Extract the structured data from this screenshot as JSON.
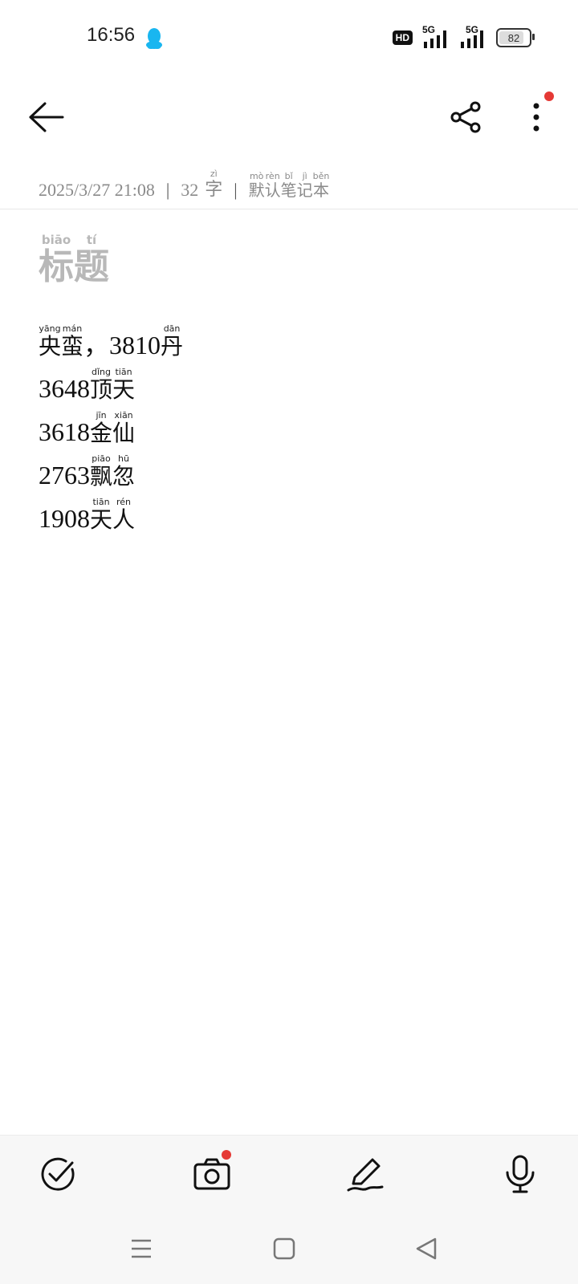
{
  "status_bar": {
    "time": "16:56",
    "network_badge": "HD",
    "sim1_label": "5G",
    "sim2_label": "5G",
    "battery_level": "82"
  },
  "toolbar": {
    "back_icon": "arrow-left-icon",
    "share_icon": "share-icon",
    "more_icon": "more-vertical-icon",
    "notification_color": "#e53935"
  },
  "meta": {
    "datetime": "2025/3/27 21:08",
    "separator": "|",
    "word_count": "32",
    "word_unit": "字",
    "word_unit_pinyin": "zì",
    "notebook": [
      {
        "char": "默",
        "pinyin": "mò"
      },
      {
        "char": "认",
        "pinyin": "rèn"
      },
      {
        "char": "笔",
        "pinyin": "bǐ"
      },
      {
        "char": "记",
        "pinyin": "jì"
      },
      {
        "char": "本",
        "pinyin": "běn"
      }
    ]
  },
  "note": {
    "title": [
      {
        "char": "标",
        "pinyin": "biāo"
      },
      {
        "char": "题",
        "pinyin": "tí"
      }
    ],
    "lines": [
      {
        "parts": [
          {
            "char": "央",
            "pinyin": "yāng"
          },
          {
            "char": "蛮",
            "pinyin": "mán"
          },
          {
            "text": "，3810"
          },
          {
            "char": "丹",
            "pinyin": "dān"
          }
        ]
      },
      {
        "parts": [
          {
            "text": "3648"
          },
          {
            "char": "顶",
            "pinyin": "dǐng"
          },
          {
            "char": "天",
            "pinyin": "tiān"
          }
        ]
      },
      {
        "parts": [
          {
            "text": "3618"
          },
          {
            "char": "金",
            "pinyin": "jīn"
          },
          {
            "char": "仙",
            "pinyin": "xiān"
          }
        ]
      },
      {
        "parts": [
          {
            "text": "2763"
          },
          {
            "char": "飘",
            "pinyin": "piāo"
          },
          {
            "char": "忽",
            "pinyin": "hū"
          }
        ]
      },
      {
        "parts": [
          {
            "text": "1908"
          },
          {
            "char": "天",
            "pinyin": "tiān"
          },
          {
            "char": "人",
            "pinyin": "rén"
          }
        ]
      }
    ]
  },
  "bottom_tools": [
    {
      "icon": "checklist-icon"
    },
    {
      "icon": "camera-icon",
      "badge_color": "#e53935"
    },
    {
      "icon": "handwriting-pen-icon"
    },
    {
      "icon": "microphone-icon"
    }
  ],
  "nav_bar": [
    "menu-icon",
    "home-square-icon",
    "back-triangle-icon"
  ]
}
